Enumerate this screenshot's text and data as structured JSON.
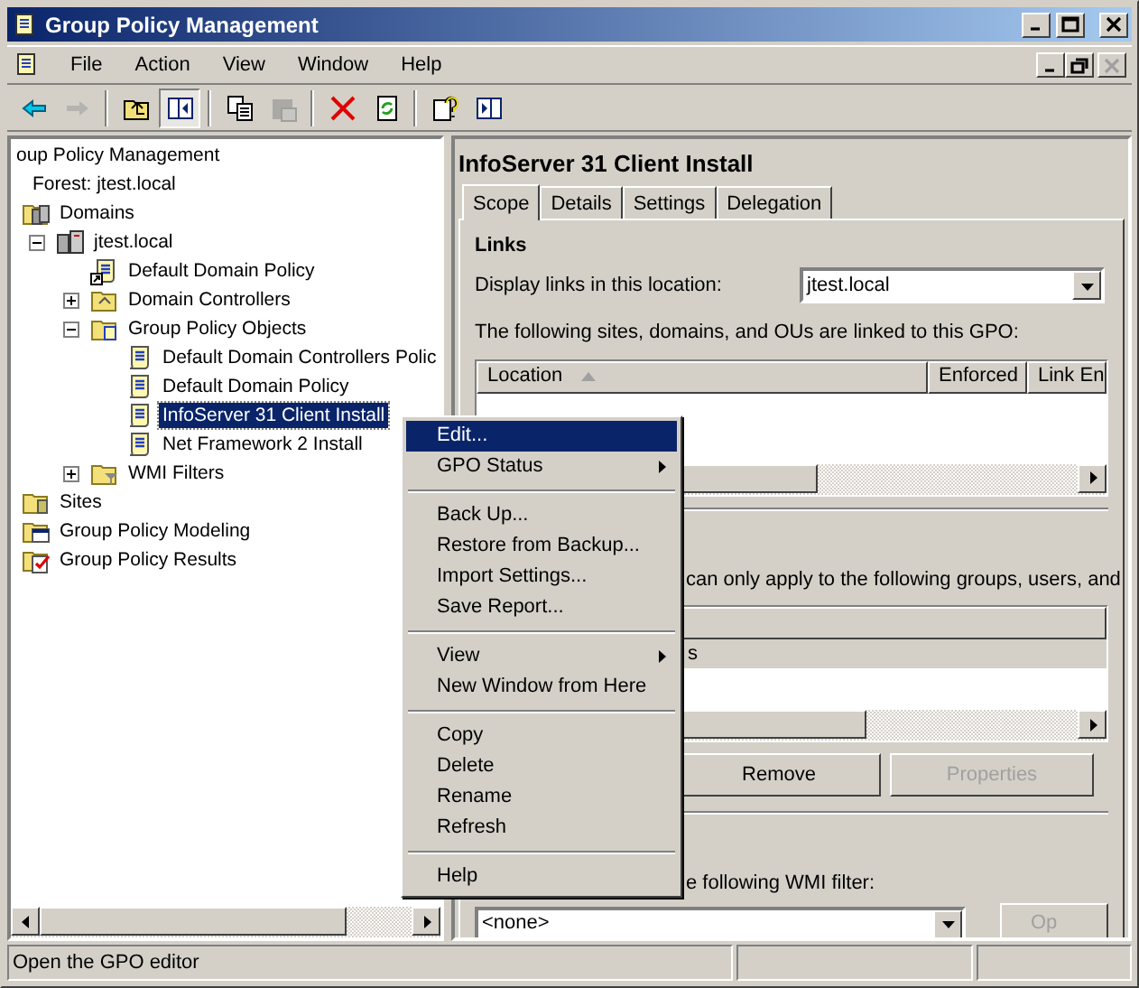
{
  "window": {
    "title": "Group Policy Management"
  },
  "menu_bar": [
    "File",
    "Action",
    "View",
    "Window",
    "Help"
  ],
  "toolbar": [
    {
      "disabled": false,
      "pressed": false
    },
    {
      "disabled": true,
      "pressed": false
    },
    {
      "disabled": false,
      "pressed": false
    },
    {
      "disabled": false,
      "pressed": true
    },
    {
      "disabled": false,
      "pressed": false
    },
    {
      "disabled": true,
      "pressed": false
    },
    {
      "disabled": false,
      "pressed": false
    },
    {
      "disabled": false,
      "pressed": false
    },
    {
      "disabled": false,
      "pressed": false
    },
    {
      "disabled": false,
      "pressed": false
    }
  ],
  "tree": [
    {
      "label": "oup Policy Management",
      "selected": false,
      "children": [
        {
          "label": "Forest: jtest.local",
          "selected": false,
          "children": [
            {
              "label": "Domains",
              "kind": "domains",
              "selected": false,
              "children": [
                {
                  "label": "jtest.local",
                  "kind": "domain",
                  "expanded": true,
                  "selected": false,
                  "children": [
                    {
                      "label": "Default Domain Policy",
                      "kind": "gpo-link",
                      "selected": false
                    },
                    {
                      "label": "Domain Controllers",
                      "kind": "ou",
                      "expanded": false,
                      "selected": false
                    },
                    {
                      "label": "Group Policy Objects",
                      "kind": "gpo-folder",
                      "expanded": true,
                      "selected": false,
                      "children": [
                        {
                          "label": "Default Domain Controllers Polic",
                          "kind": "gpo",
                          "selected": false
                        },
                        {
                          "label": "Default Domain Policy",
                          "kind": "gpo",
                          "selected": false
                        },
                        {
                          "label": "InfoServer 31 Client Install",
                          "kind": "gpo",
                          "selected": true
                        },
                        {
                          "label": "Net Framework 2 Install",
                          "kind": "gpo",
                          "selected": false
                        }
                      ]
                    },
                    {
                      "label": "WMI Filters",
                      "kind": "wmi",
                      "expanded": false,
                      "selected": false
                    }
                  ]
                }
              ]
            },
            {
              "label": "Sites",
              "kind": "sites",
              "selected": false
            },
            {
              "label": "Group Policy Modeling",
              "kind": "modeling",
              "selected": false
            },
            {
              "label": "Group Policy Results",
              "kind": "results",
              "selected": false
            }
          ]
        }
      ]
    }
  ],
  "details": {
    "title": "InfoServer 31 Client Install",
    "tabs": [
      {
        "label": "Scope",
        "selected": true
      },
      {
        "label": "Details",
        "selected": false
      },
      {
        "label": "Settings",
        "selected": false
      },
      {
        "label": "Delegation",
        "selected": false
      }
    ],
    "links": {
      "heading": "Links",
      "location_label": "Display links in this location:",
      "location_value": "jtest.local",
      "list_caption": "The following sites, domains, and OUs are linked to this GPO:",
      "columns": [
        "Location",
        "Enforced",
        "Link En"
      ]
    },
    "security": {
      "caption": "can only apply to the following groups, users, and",
      "rows": [
        "s"
      ],
      "buttons": [
        {
          "label": "Remove",
          "disabled": false
        },
        {
          "label": "Properties",
          "disabled": true
        }
      ]
    },
    "wmi": {
      "caption": "e following WMI filter:",
      "value": "<none>",
      "button": {
        "label": "Op",
        "disabled": true
      }
    }
  },
  "context_menu": [
    {
      "kind": "item",
      "label": "Edit...",
      "submenu": false,
      "selected": true
    },
    {
      "kind": "item",
      "label": "GPO Status",
      "submenu": true,
      "selected": false
    },
    {
      "kind": "separator"
    },
    {
      "kind": "item",
      "label": "Back Up...",
      "submenu": false,
      "selected": false
    },
    {
      "kind": "item",
      "label": "Restore from Backup...",
      "submenu": false,
      "selected": false
    },
    {
      "kind": "item",
      "label": "Import Settings...",
      "submenu": false,
      "selected": false
    },
    {
      "kind": "item",
      "label": "Save Report...",
      "submenu": false,
      "selected": false
    },
    {
      "kind": "separator"
    },
    {
      "kind": "item",
      "label": "View",
      "submenu": true,
      "selected": false
    },
    {
      "kind": "item",
      "label": "New Window from Here",
      "submenu": false,
      "selected": false
    },
    {
      "kind": "separator"
    },
    {
      "kind": "item",
      "label": "Copy",
      "submenu": false,
      "selected": false
    },
    {
      "kind": "item",
      "label": "Delete",
      "submenu": false,
      "selected": false
    },
    {
      "kind": "item",
      "label": "Rename",
      "submenu": false,
      "selected": false
    },
    {
      "kind": "item",
      "label": "Refresh",
      "submenu": false,
      "selected": false
    },
    {
      "kind": "separator"
    },
    {
      "kind": "item",
      "label": "Help",
      "submenu": false,
      "selected": false
    }
  ],
  "status_bar": {
    "text": "Open the GPO editor"
  }
}
